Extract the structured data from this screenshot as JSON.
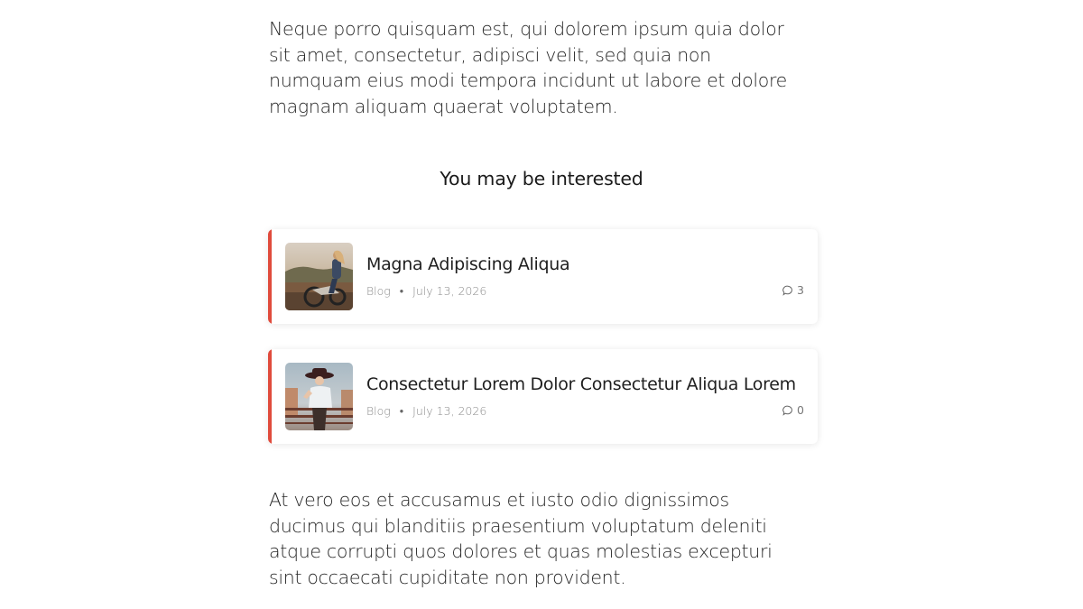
{
  "article": {
    "paragraph_top": "Neque porro quisquam est, qui dolorem ipsum quia dolor sit amet, consectetur, adipisci velit, sed quia non numquam eius modi tempora incidunt ut labore et dolore magnam aliquam quaerat voluptatem.",
    "paragraph_bottom": "At vero eos et accusamus et iusto odio dignissimos ducimus qui blanditiis praesentium voluptatum deleniti atque corrupti quos dolores et quas molestias excepturi sint occaecati cupiditate non provident."
  },
  "related": {
    "heading": "You may be interested",
    "accent_color": "#e04b3c",
    "items": [
      {
        "title": "Magna Adipiscing Aliqua",
        "category": "Blog",
        "date": "July 13, 2026",
        "comment_count": "3",
        "thumbnail": "woman-on-motorcycle-photo"
      },
      {
        "title": "Consectetur Lorem Dolor Consectetur Aliqua Lorem",
        "category": "Blog",
        "date": "July 13, 2026",
        "comment_count": "0",
        "thumbnail": "woman-in-hat-photo"
      }
    ]
  }
}
